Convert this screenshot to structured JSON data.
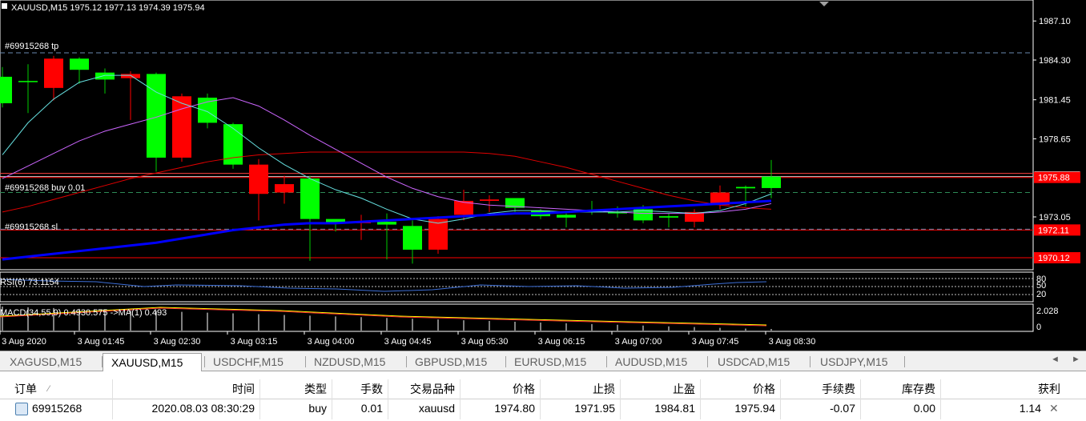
{
  "chart": {
    "header": "XAUUSD,M15  1975.12 1977.13 1974.39 1975.94",
    "order_tp_label": "#69915268 tp",
    "order_buy_label": "#69915268 buy 0.01",
    "order_sl_label": "#69915268 sl",
    "rsi_label": "RSI(6) 73.1154",
    "macd_label": "MACD(34,55,9) 0.4930.575 ->MA(1) 0.493",
    "price_axis": [
      "1987.10",
      "1984.30",
      "1981.45",
      "1978.65",
      "1973.05"
    ],
    "price_markers": {
      "current": "1975.94",
      "buy": "1975.88",
      "sl": "1972.11",
      "low": "1970.12"
    },
    "rsi_axis": [
      "80",
      "50",
      "20"
    ],
    "macd_axis": [
      "2.028",
      "0"
    ],
    "time_axis": [
      "3 Aug 2020",
      "3 Aug 01:45",
      "3 Aug 02:30",
      "3 Aug 03:15",
      "3 Aug 04:00",
      "3 Aug 04:45",
      "3 Aug 05:30",
      "3 Aug 06:15",
      "3 Aug 07:00",
      "3 Aug 07:45",
      "3 Aug 08:30"
    ],
    "colors": {
      "bull": "#00ff00",
      "bear": "#ff0000",
      "ma_fast": "#0000ff",
      "ma_purple": "#cc66ff",
      "ma_cyan": "#66e0e0",
      "ma_red": "#e00000"
    },
    "candles": [
      {
        "o": 1981.2,
        "h": 1983.8,
        "l": 1980.9,
        "c": 1983.1
      },
      {
        "o": 1982.8,
        "h": 1984.0,
        "l": 1980.5,
        "c": 1982.8
      },
      {
        "o": 1984.4,
        "h": 1984.6,
        "l": 1981.4,
        "c": 1982.3
      },
      {
        "o": 1983.6,
        "h": 1984.5,
        "l": 1982.6,
        "c": 1984.4
      },
      {
        "o": 1982.9,
        "h": 1983.7,
        "l": 1981.9,
        "c": 1983.4
      },
      {
        "o": 1983.3,
        "h": 1983.5,
        "l": 1980.0,
        "c": 1983.0
      },
      {
        "o": 1977.3,
        "h": 1983.4,
        "l": 1976.3,
        "c": 1983.3
      },
      {
        "o": 1981.7,
        "h": 1981.9,
        "l": 1977.0,
        "c": 1977.3
      },
      {
        "o": 1979.8,
        "h": 1981.9,
        "l": 1979.4,
        "c": 1981.6
      },
      {
        "o": 1976.8,
        "h": 1979.8,
        "l": 1976.5,
        "c": 1979.7
      },
      {
        "o": 1976.8,
        "h": 1977.2,
        "l": 1972.8,
        "c": 1974.7
      },
      {
        "o": 1975.4,
        "h": 1976.0,
        "l": 1974.0,
        "c": 1974.8
      },
      {
        "o": 1972.9,
        "h": 1976.0,
        "l": 1969.9,
        "c": 1975.8
      },
      {
        "o": 1972.6,
        "h": 1972.8,
        "l": 1972.0,
        "c": 1972.9
      },
      {
        "o": 1972.7,
        "h": 1973.2,
        "l": 1971.4,
        "c": 1972.6
      },
      {
        "o": 1972.5,
        "h": 1973.3,
        "l": 1970.0,
        "c": 1972.7
      },
      {
        "o": 1970.7,
        "h": 1972.8,
        "l": 1969.7,
        "c": 1972.4
      },
      {
        "o": 1972.9,
        "h": 1973.1,
        "l": 1970.4,
        "c": 1970.7
      },
      {
        "o": 1974.2,
        "h": 1975.0,
        "l": 1972.8,
        "c": 1973.2
      },
      {
        "o": 1974.3,
        "h": 1974.6,
        "l": 1973.4,
        "c": 1974.2
      },
      {
        "o": 1973.7,
        "h": 1974.4,
        "l": 1973.4,
        "c": 1974.4
      },
      {
        "o": 1973.1,
        "h": 1973.6,
        "l": 1972.9,
        "c": 1973.5
      },
      {
        "o": 1973.0,
        "h": 1973.3,
        "l": 1972.3,
        "c": 1973.2
      },
      {
        "o": 1973.4,
        "h": 1974.2,
        "l": 1973.2,
        "c": 1973.5
      },
      {
        "o": 1973.3,
        "h": 1973.8,
        "l": 1973.0,
        "c": 1973.4
      },
      {
        "o": 1972.8,
        "h": 1973.9,
        "l": 1972.6,
        "c": 1973.6
      },
      {
        "o": 1973.0,
        "h": 1973.3,
        "l": 1972.3,
        "c": 1973.1
      },
      {
        "o": 1973.4,
        "h": 1973.6,
        "l": 1972.3,
        "c": 1972.7
      },
      {
        "o": 1974.8,
        "h": 1975.3,
        "l": 1973.6,
        "c": 1973.9
      },
      {
        "o": 1975.1,
        "h": 1975.3,
        "l": 1973.8,
        "c": 1975.2
      },
      {
        "o": 1975.12,
        "h": 1977.13,
        "l": 1974.39,
        "c": 1975.94
      }
    ]
  },
  "tabs": [
    "XAGUSD,M15",
    "XAUUSD,M15",
    "USDCHF,M15",
    "NZDUSD,M15",
    "GBPUSD,M15",
    "EURUSD,M15",
    "AUDUSD,M15",
    "USDCAD,M15",
    "USDJPY,M15"
  ],
  "tab_nav": {
    "prev": "◄",
    "next": "►"
  },
  "terminal": {
    "headers": [
      "订单",
      "时间",
      "类型",
      "手数",
      "交易品种",
      "价格",
      "止损",
      "止盈",
      "价格",
      "手续费",
      "库存费",
      "获利"
    ],
    "sort_indicator": "⁄",
    "row": [
      "69915268",
      "2020.08.03 08:30:29",
      "buy",
      "0.01",
      "xauusd",
      "1974.80",
      "1971.95",
      "1984.81",
      "1975.94",
      "-0.07",
      "0.00",
      "1.14"
    ],
    "close_glyph": "✕"
  }
}
